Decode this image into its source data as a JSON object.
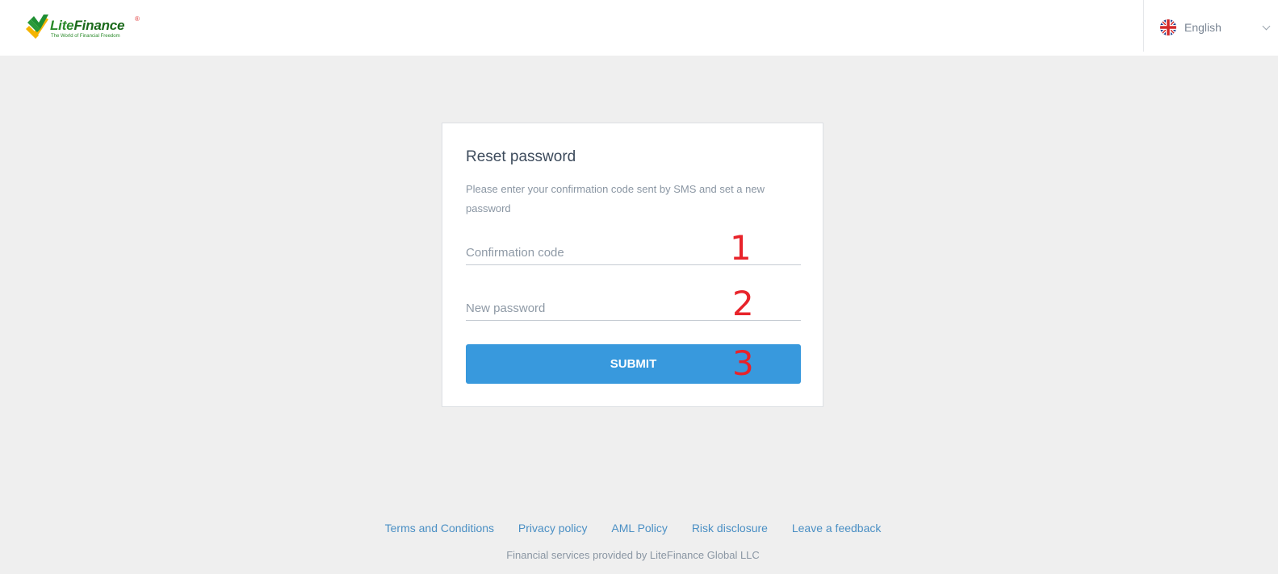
{
  "header": {
    "logo": {
      "brand_lite": "Lite",
      "brand_finance": "Finance",
      "registered_mark": "®",
      "tagline": "The World of Financial Freedom"
    },
    "language": {
      "label": "English",
      "flag_icon": "uk-flag-icon",
      "chevron_icon": "chevron-down-icon"
    }
  },
  "card": {
    "title": "Reset password",
    "description": "Please enter your confirmation code sent by SMS and set a new password",
    "confirmation_code": {
      "placeholder": "Confirmation code",
      "value": ""
    },
    "new_password": {
      "placeholder": "New password",
      "value": ""
    },
    "submit_label": "SUBMIT"
  },
  "annotations": {
    "step1": "1",
    "step2": "2",
    "step3": "3",
    "color": "#e8232a"
  },
  "footer": {
    "links": [
      "Terms and Conditions",
      "Privacy policy",
      "AML Policy",
      "Risk disclosure",
      "Leave a feedback"
    ],
    "note": "Financial services provided by LiteFinance Global LLC"
  },
  "colors": {
    "accent": "#3899dd",
    "background": "#efefef",
    "link": "#4a8fc4"
  }
}
